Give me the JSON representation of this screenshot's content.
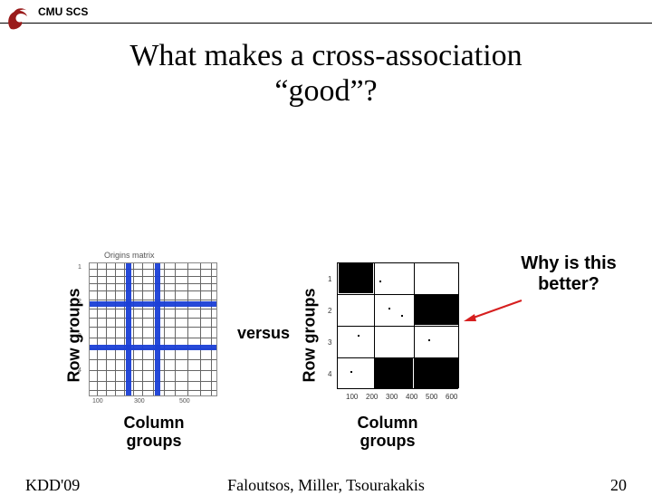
{
  "header": {
    "org": "CMU SCS"
  },
  "title_line1": "What makes a cross-association",
  "title_line2": "“good”?",
  "left_fig_title": "Origins matrix",
  "axis": {
    "row_groups": "Row groups",
    "column_groups": "Column\ngroups"
  },
  "versus": "versus",
  "callout": "Why is this better?",
  "right_ticks": [
    "100",
    "200",
    "300",
    "400",
    "500",
    "600"
  ],
  "right_yticks": [
    "1",
    "2",
    "3",
    "4"
  ],
  "footer": {
    "left": "KDD'09",
    "center": "Faloutsos, Miller, Tsourakakis",
    "page": "20"
  }
}
